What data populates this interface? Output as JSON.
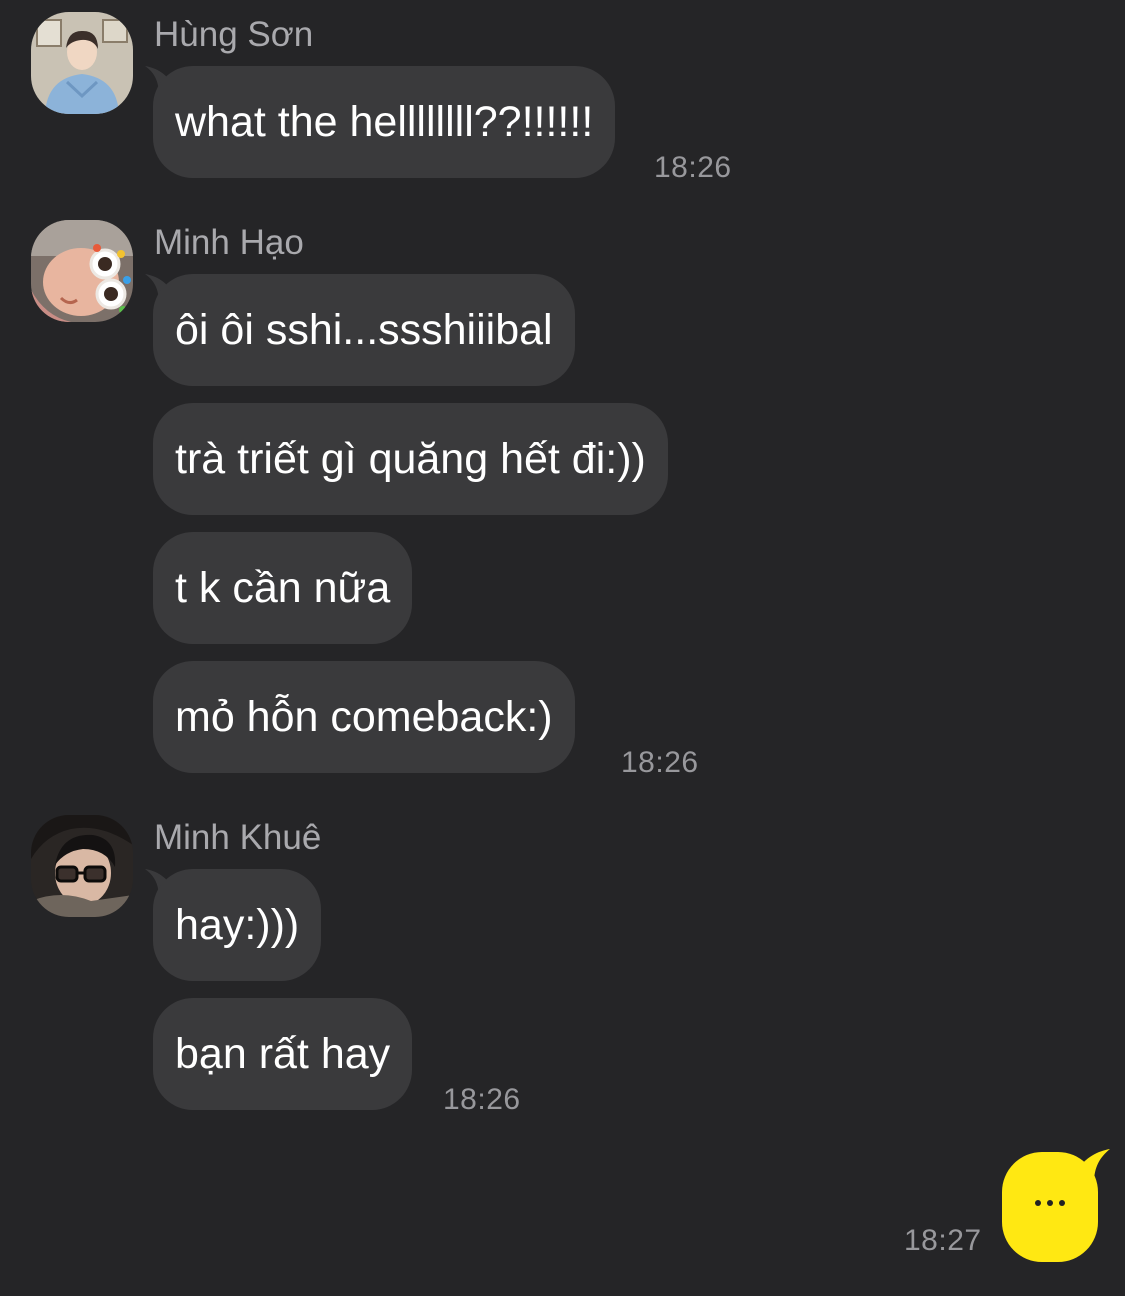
{
  "messages": {
    "group1": {
      "sender": "Hùng Sơn",
      "bubbles": [
        "what the hellllllll??!!!!!!"
      ],
      "time": "18:26"
    },
    "group2": {
      "sender": "Minh Hạo",
      "bubbles": [
        "ôi ôi sshi...ssshiiibal",
        "trà triết gì quăng hết đi:))",
        "t k cần nữa",
        "mỏ hỗn comeback:)"
      ],
      "time": "18:26"
    },
    "group3": {
      "sender": "Minh Khuê",
      "bubbles": [
        "hay:)))",
        "bạn rất hay"
      ],
      "time": "18:26"
    },
    "outgoing": {
      "time": "18:27",
      "status": "typing"
    }
  },
  "colors": {
    "background": "#252527",
    "incoming_bubble": "#3a3a3c",
    "outgoing_bubble": "#ffe812",
    "sender_name": "#a9a9ad",
    "timestamp": "#98989c"
  }
}
